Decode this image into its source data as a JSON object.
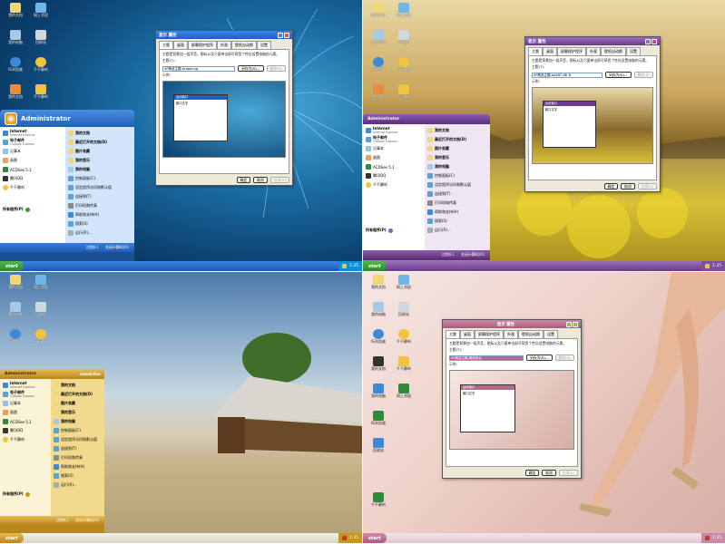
{
  "user": "Administrator",
  "classic_label": "classicflux",
  "start_label": "start",
  "tray_time": "1:35",
  "desktop_icons": [
    "我的文档",
    "网上邻居",
    "回收站",
    "我的电脑",
    "IE浏览器",
    "千千静听"
  ],
  "start_menu": {
    "left_items": [
      {
        "title": "Internet",
        "sub": "Internet Explorer"
      },
      {
        "title": "电子邮件",
        "sub": "Outlook Express"
      },
      {
        "title": "记事本",
        "sub": ""
      },
      {
        "title": "画图",
        "sub": ""
      },
      {
        "title": "ACDSee 5.1",
        "sub": ""
      },
      {
        "title": "腾讯QQ",
        "sub": ""
      },
      {
        "title": "千千静听",
        "sub": ""
      }
    ],
    "right_items": [
      "我的文档",
      "最近打开的文档(D)",
      "图片收藏",
      "我的音乐",
      "我的电脑",
      "控制面板(C)",
      "设定程序访问和默认值",
      "连接到(T)",
      "打印机和传真",
      "帮助和支持(H)",
      "搜索(S)",
      "运行(R)..."
    ],
    "all_programs": "所有程序(P)",
    "logoff": "注销(L)",
    "shutdown": "关闭计算机(U)"
  },
  "dialog": {
    "title": "显示 属性",
    "tabs": [
      "主题",
      "桌面",
      "屏幕保护程序",
      "外观",
      "壁纸自动换",
      "设置"
    ],
    "desc": "主题是背景加一组声音，图标以及只要单击即可帮您个性化设置电脑的元素。",
    "theme_label": "主题(T):",
    "theme_values": [
      "XP精选主题-Aragorn\\g",
      "XP精选主题-AeART LBI B",
      "XP精选主题-雅致粉色",
      "XP精选主题-雅致粉色"
    ],
    "saveas": "另存为(S)...",
    "delete": "删除(D)",
    "sample_label": "示例:",
    "active_window": "活动窗口",
    "window_text": "窗口文字",
    "ok": "确定",
    "cancel": "取消",
    "apply": "应用(A)"
  },
  "colors": {
    "blue": "#1b5fb1",
    "purple": "#6a3b8e",
    "gold": "#c9941f",
    "pink": "#b06d8b",
    "tray_blue": "#0e8fd8"
  }
}
